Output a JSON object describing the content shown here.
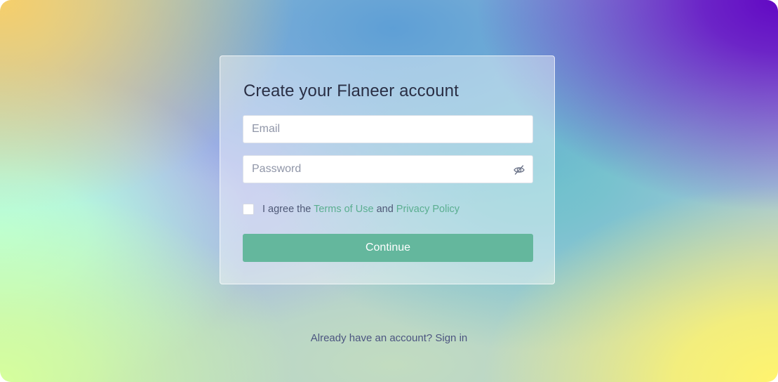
{
  "signup": {
    "title": "Create your Flaneer account",
    "email_placeholder": "Email",
    "email_value": "",
    "password_placeholder": "Password",
    "password_value": "",
    "password_toggle_icon": "eye-off-icon",
    "agree_prefix": "I agree the",
    "terms_link": "Terms of Use",
    "agree_and": "and",
    "privacy_link": "Privacy Policy",
    "agree_checked": false,
    "continue_label": "Continue"
  },
  "footer": {
    "prompt": "Already have an account?",
    "signin_link": "Sign in"
  },
  "colors": {
    "accent": "#64b79d",
    "link": "#5aae90",
    "text": "#2a2f45"
  }
}
